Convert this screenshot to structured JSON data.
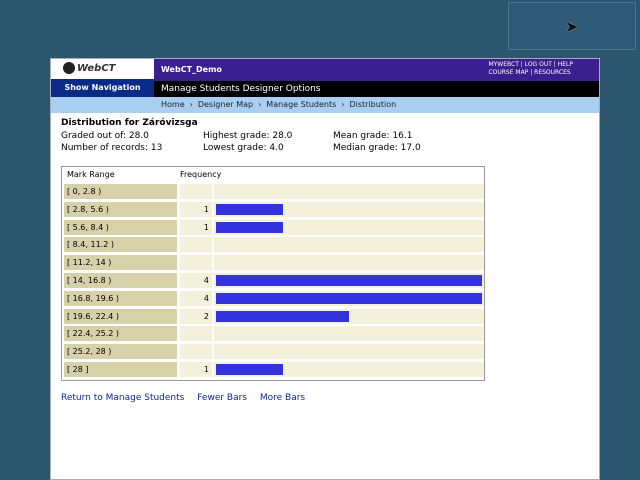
{
  "header": {
    "logo_text": "WebCT",
    "show_navigation": "Show Navigation",
    "course_title": "WebCT_Demo",
    "top_links_line1": "MYWEBCT | LOG OUT | HELP",
    "top_links_line2": "COURSE MAP | RESOURCES",
    "mode_bar": "Manage Students  Designer Options"
  },
  "breadcrumb": [
    "Home",
    "Designer Map",
    "Manage Students",
    "Distribution"
  ],
  "page_title": "Distribution for Záróvizsga",
  "stats": {
    "graded_out_of": "Graded out of: 28.0",
    "number_of_records": "Number of records: 13",
    "highest": "Highest grade: 28.0",
    "lowest": "Lowest grade: 4.0",
    "mean": "Mean grade: 16.1",
    "median": "Median grade: 17.0"
  },
  "grid": {
    "header_range": "Mark Range",
    "header_freq": "Frequency"
  },
  "rows": [
    {
      "range": "[ 0, 2.8 )",
      "count": ""
    },
    {
      "range": "[ 2.8, 5.6 )",
      "count": "1"
    },
    {
      "range": "[ 5.6, 8.4 )",
      "count": "1"
    },
    {
      "range": "[ 8.4, 11.2 )",
      "count": ""
    },
    {
      "range": "[ 11.2, 14 )",
      "count": ""
    },
    {
      "range": "[ 14, 16.8 )",
      "count": "4"
    },
    {
      "range": "[ 16.8, 19.6 )",
      "count": "4"
    },
    {
      "range": "[ 19.6, 22.4 )",
      "count": "2"
    },
    {
      "range": "[ 22.4, 25.2 )",
      "count": ""
    },
    {
      "range": "[ 25.2, 28 )",
      "count": ""
    },
    {
      "range": "[ 28 ]",
      "count": "1"
    }
  ],
  "footer": {
    "return": "Return to Manage Students",
    "fewer": "Fewer Bars",
    "more": "More Bars"
  },
  "colors": {
    "bar": "#3333dd",
    "header": "#3a1f8f"
  }
}
